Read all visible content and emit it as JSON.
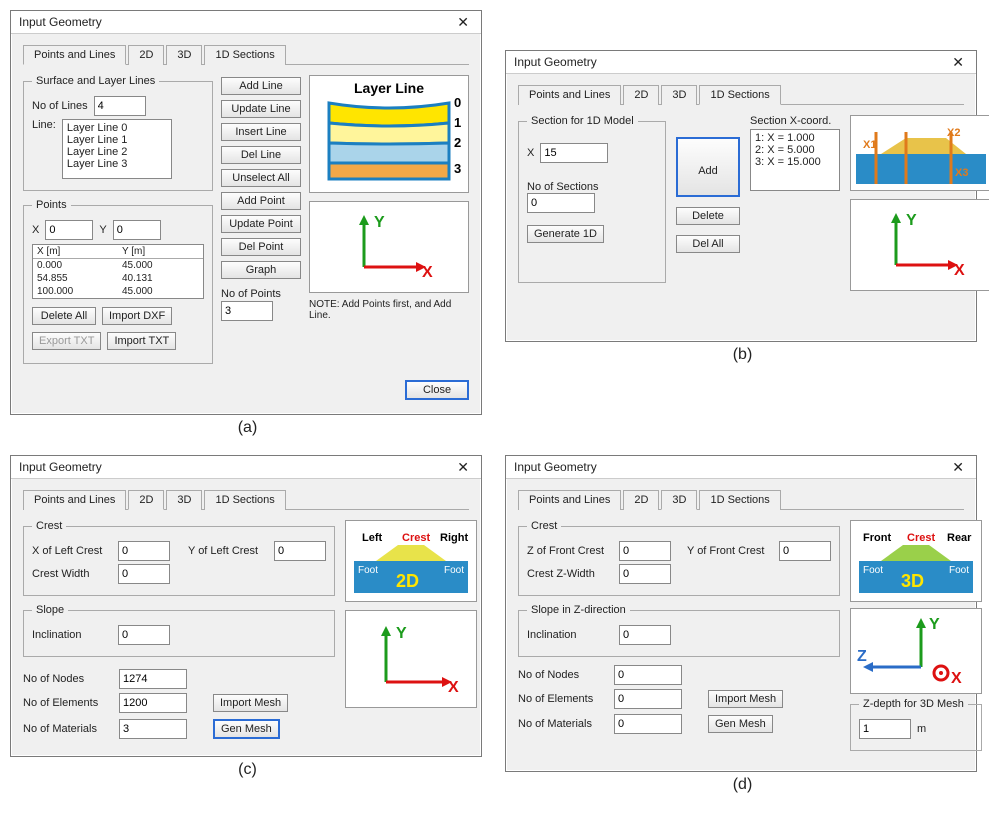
{
  "shared": {
    "dialog_title": "Input Geometry",
    "tabs": {
      "pl": "Points and Lines",
      "d2": "2D",
      "d3": "3D",
      "d1": "1D Sections"
    }
  },
  "panelA": {
    "fs_surface": "Surface and Layer Lines",
    "no_of_lines_label": "No of Lines",
    "no_of_lines": "4",
    "line_label": "Line:",
    "lines_list": [
      "Layer Line 0",
      "Layer Line 1",
      "Layer Line 2",
      "Layer Line 3"
    ],
    "btns": {
      "add_line": "Add Line",
      "update_line": "Update Line",
      "insert_line": "Insert Line",
      "del_line": "Del Line",
      "unselect_all": "Unselect All",
      "add_point": "Add Point",
      "update_point": "Update Point",
      "del_point": "Del Point",
      "graph": "Graph"
    },
    "points_fs": "Points",
    "x_label": "X",
    "y_label": "Y",
    "x_val": "0",
    "y_val": "0",
    "tbl_hdr_x": "X [m]",
    "tbl_hdr_y": "Y [m]",
    "tbl_rows": [
      [
        "0.000",
        "45.000"
      ],
      [
        "54.855",
        "40.131"
      ],
      [
        "100.000",
        "45.000"
      ]
    ],
    "delete_all": "Delete All",
    "import_dxf": "Import DXF",
    "export_txt": "Export TXT",
    "import_txt": "Import TXT",
    "no_of_points_label": "No of Points",
    "no_of_points": "3",
    "ill_title": "Layer Line",
    "note": "NOTE: Add Points first, and Add Line.",
    "close": "Close"
  },
  "panelB": {
    "fs": "Section for 1D Model",
    "x_label": "X",
    "x_val": "15",
    "no_sec_label": "No of Sections",
    "no_sec": "0",
    "gen1d": "Generate 1D",
    "add": "Add",
    "delete": "Delete",
    "delall": "Del All",
    "sec_coord_title": "Section X-coord.",
    "coords": [
      "1: X =   1.000",
      "2: X =   5.000",
      "3: X =  15.000"
    ]
  },
  "panelC": {
    "crest_fs": "Crest",
    "x_left_label": "X of Left Crest",
    "x_left": "0",
    "y_left_label": "Y of Left Crest",
    "y_left": "0",
    "crest_w_label": "Crest Width",
    "crest_w": "0",
    "slope_fs": "Slope",
    "incl_label": "Inclination",
    "incl": "0",
    "nodes_label": "No of Nodes",
    "nodes": "1274",
    "elems_label": "No of Elements",
    "elems": "1200",
    "mats_label": "No of Materials",
    "mats": "3",
    "import_mesh": "Import Mesh",
    "gen_mesh": "Gen Mesh",
    "ill": {
      "left": "Left",
      "crest": "Crest",
      "right": "Right",
      "foot": "Foot",
      "big": "2D"
    }
  },
  "panelD": {
    "crest_fs": "Crest",
    "z_front_label": "Z of Front Crest",
    "z_front": "0",
    "y_front_label": "Y of Front Crest",
    "y_front": "0",
    "crest_zw_label": "Crest Z-Width",
    "crest_zw": "0",
    "slope_fs": "Slope in Z-direction",
    "incl_label": "Inclination",
    "incl": "0",
    "nodes_label": "No of Nodes",
    "nodes": "0",
    "elems_label": "No of Elements",
    "elems": "0",
    "mats_label": "No of Materials",
    "mats": "0",
    "import_mesh": "Import Mesh",
    "gen_mesh": "Gen Mesh",
    "ill": {
      "front": "Front",
      "crest": "Crest",
      "rear": "Rear",
      "foot": "Foot",
      "big": "3D"
    },
    "zdepth_fs": "Z-depth for 3D Mesh",
    "zdepth": "1",
    "zdepth_unit": "m"
  },
  "captions": {
    "a": "(a)",
    "b": "(b)",
    "c": "(c)",
    "d": "(d)"
  }
}
